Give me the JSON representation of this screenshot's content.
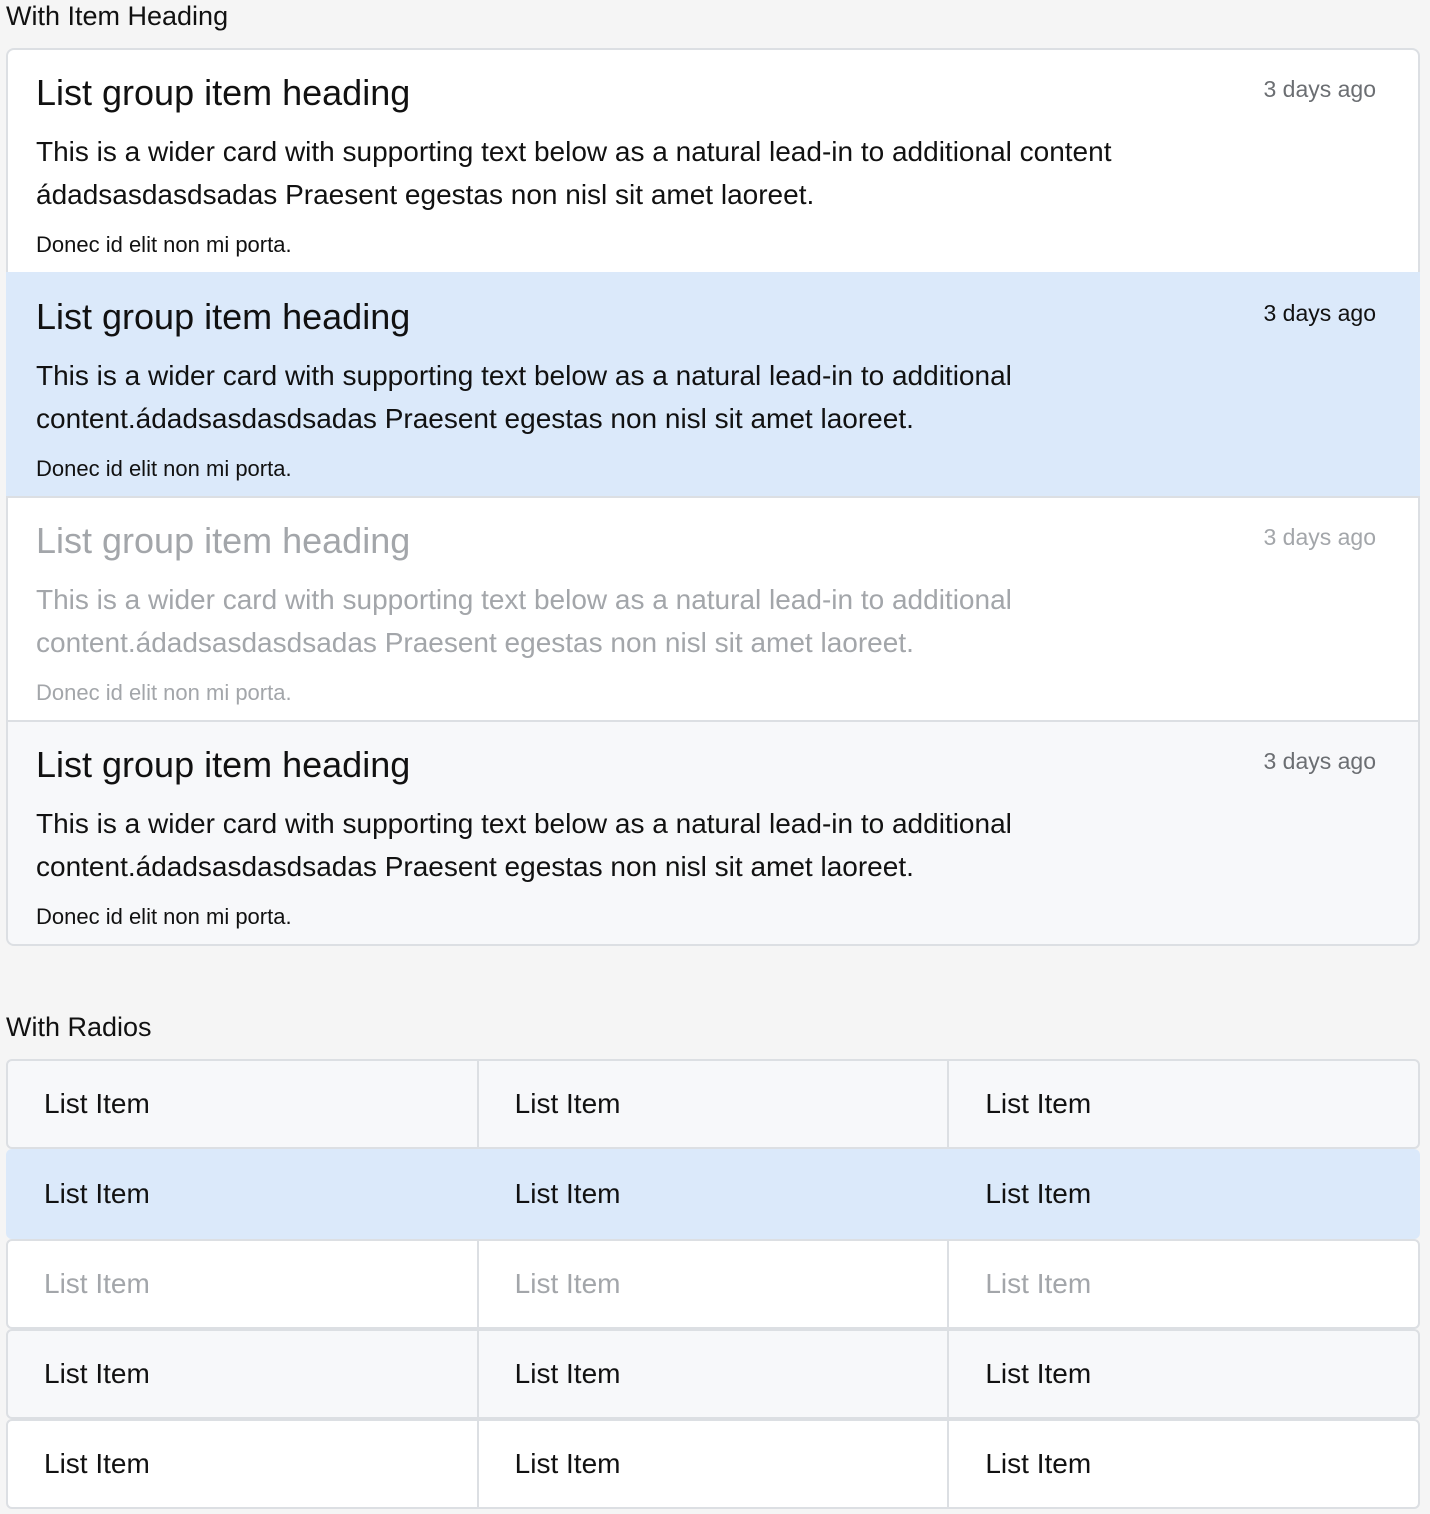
{
  "sections": {
    "heading_title": "With Item Heading",
    "radios_title": "With Radios"
  },
  "list_group": {
    "items": [
      {
        "heading": "List group item heading",
        "time": "3 days ago",
        "text": "This is a wider card with supporting text below as a natural lead-in to additional content ádadsasdasdsadas Praesent egestas non nisl sit amet laoreet.",
        "small": "Donec id elit non mi porta.",
        "state": "default"
      },
      {
        "heading": "List group item heading",
        "time": "3 days ago",
        "text": "This is a wider card with supporting text below as a natural lead-in to additional content.ádadsasdasdsadas Praesent egestas non nisl sit amet laoreet.",
        "small": "Donec id elit non mi porta.",
        "state": "active"
      },
      {
        "heading": "List group item heading",
        "time": "3 days ago",
        "text": "This is a wider card with supporting text below as a natural lead-in to additional content.ádadsasdasdsadas Praesent egestas non nisl sit amet laoreet.",
        "small": "Donec id elit non mi porta.",
        "state": "disabled"
      },
      {
        "heading": "List group item heading",
        "time": "3 days ago",
        "text": "This is a wider card with supporting text below as a natural lead-in to additional content.ádadsasdasdsadas Praesent egestas non nisl sit amet laoreet.",
        "small": "Donec id elit non mi porta.",
        "state": "light"
      }
    ]
  },
  "radios": {
    "rows": [
      {
        "state": "light",
        "cells": [
          "List Item",
          "List Item",
          "List Item"
        ]
      },
      {
        "state": "active",
        "cells": [
          "List Item",
          "List Item",
          "List Item"
        ]
      },
      {
        "state": "disabled",
        "cells": [
          "List Item",
          "List Item",
          "List Item"
        ]
      },
      {
        "state": "light",
        "cells": [
          "List Item",
          "List Item",
          "List Item"
        ]
      },
      {
        "state": "default",
        "cells": [
          "List Item",
          "List Item",
          "List Item"
        ]
      }
    ]
  },
  "colors": {
    "active_bg": "#dbe9fa",
    "disabled_text": "#a3a6aa",
    "border": "#dcdfe3",
    "light_bg": "#f7f8fa"
  }
}
